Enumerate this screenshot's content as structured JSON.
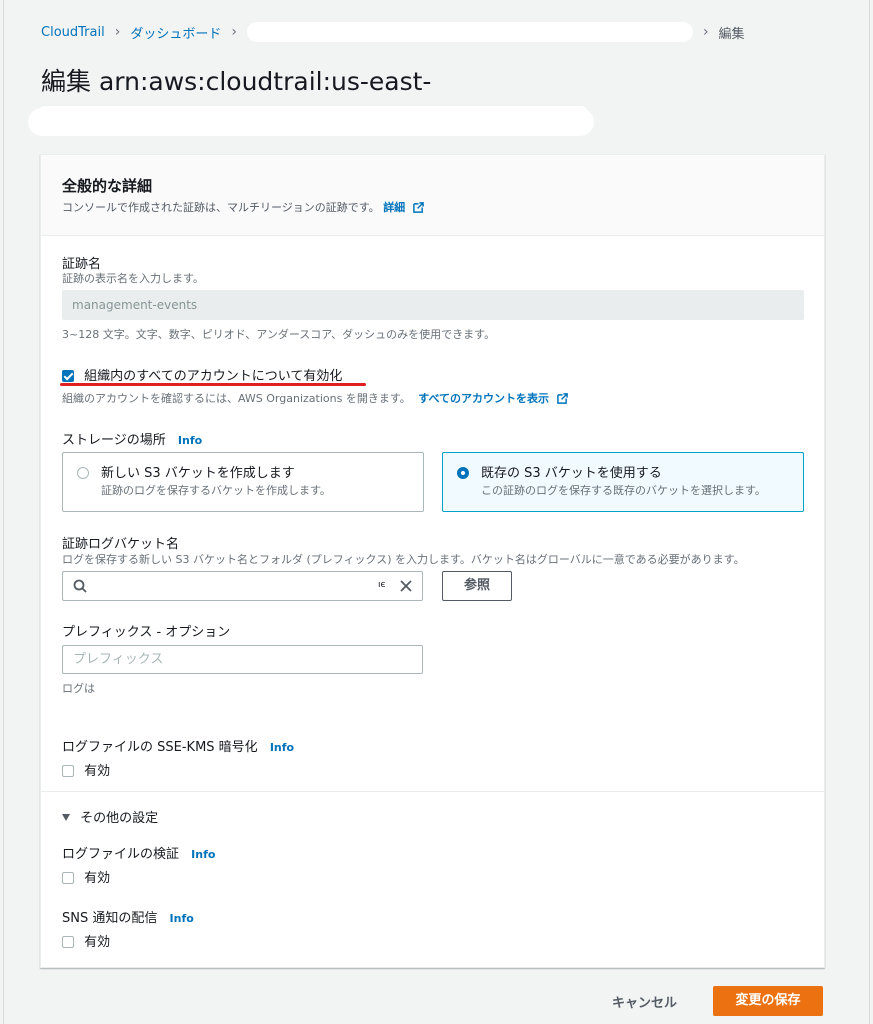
{
  "breadcrumb": {
    "items": [
      "CloudTrail",
      "ダッシュボード"
    ],
    "current": "編集"
  },
  "page": {
    "title": "編集 arn:aws:cloudtrail:us-east-"
  },
  "general": {
    "title": "全般的な詳細",
    "description": "コンソールで作成された証跡は、マルチリージョンの証跡です。",
    "details_link": "詳細"
  },
  "trail_name": {
    "label": "証跡名",
    "hint": "証跡の表示名を入力します。",
    "value": "management-events",
    "constraint": "3~128 文字。文字、数字、ピリオド、アンダースコア、ダッシュのみを使用できます。"
  },
  "org": {
    "checkbox_label": "組織内のすべてのアカウントについて有効化",
    "checked": true,
    "hint": "組織のアカウントを確認するには、AWS Organizations を開きます。",
    "link": "すべてのアカウントを表示"
  },
  "storage": {
    "label": "ストレージの場所",
    "info": "Info",
    "options": [
      {
        "label": "新しい S3 バケットを作成します",
        "desc": "証跡のログを保存するバケットを作成します。",
        "selected": false
      },
      {
        "label": "既存の S3 バケットを使用する",
        "desc": "この証跡のログを保存する既存のバケットを選択します。",
        "selected": true
      }
    ]
  },
  "bucket": {
    "label": "証跡ログバケット名",
    "hint": "ログを保存する新しい S3 バケット名とフォルダ (プレフィックス) を入力します。バケット名はグローバルに一意である必要があります。",
    "truncated_value": "ıє",
    "browse_label": "参照"
  },
  "prefix": {
    "label": "プレフィックス - オプション",
    "placeholder": "プレフィックス",
    "hint": "ログは"
  },
  "sse_kms": {
    "label": "ログファイルの SSE-KMS 暗号化",
    "info": "Info",
    "checkbox_label": "有効"
  },
  "other": {
    "toggle_label": "その他の設定"
  },
  "validation": {
    "label": "ログファイルの検証",
    "info": "Info",
    "checkbox_label": "有効"
  },
  "sns": {
    "label": "SNS 通知の配信",
    "info": "Info",
    "checkbox_label": "有効"
  },
  "footer": {
    "cancel_label": "キャンセル",
    "save_label": "変更の保存"
  },
  "colors": {
    "primary": "#ec7211",
    "link": "#0073bb",
    "underline": "#e02020"
  },
  "icons": [
    "chevron-right-icon",
    "external-link-icon",
    "search-icon",
    "close-icon",
    "caret-down-icon"
  ]
}
